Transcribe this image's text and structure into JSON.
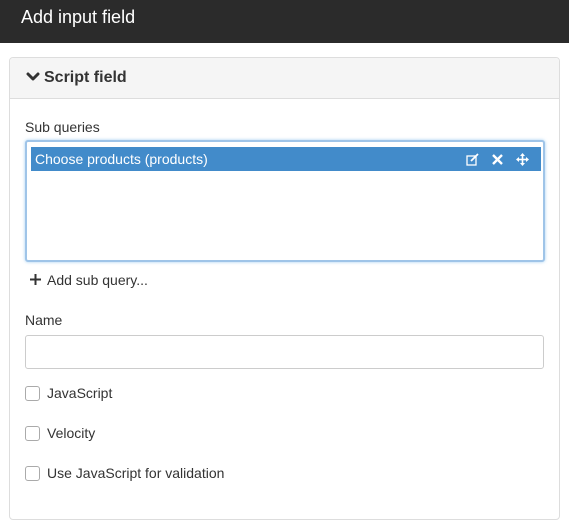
{
  "dialog": {
    "title": "Add input field"
  },
  "panel": {
    "title": "Script field",
    "collapse_icon": "chevron-down-icon"
  },
  "sub_queries": {
    "label": "Sub queries",
    "items": [
      {
        "label": "Choose products (products)",
        "actions": [
          "edit-icon",
          "close-icon",
          "move-icon"
        ]
      }
    ],
    "add_label": "Add sub query..."
  },
  "name": {
    "label": "Name",
    "value": "",
    "placeholder": ""
  },
  "options": [
    {
      "label": "JavaScript",
      "checked": false
    },
    {
      "label": "Velocity",
      "checked": false
    },
    {
      "label": "Use JavaScript for validation",
      "checked": false
    }
  ],
  "colors": {
    "accent": "#428bca",
    "titlebar": "#2b2b2b"
  }
}
